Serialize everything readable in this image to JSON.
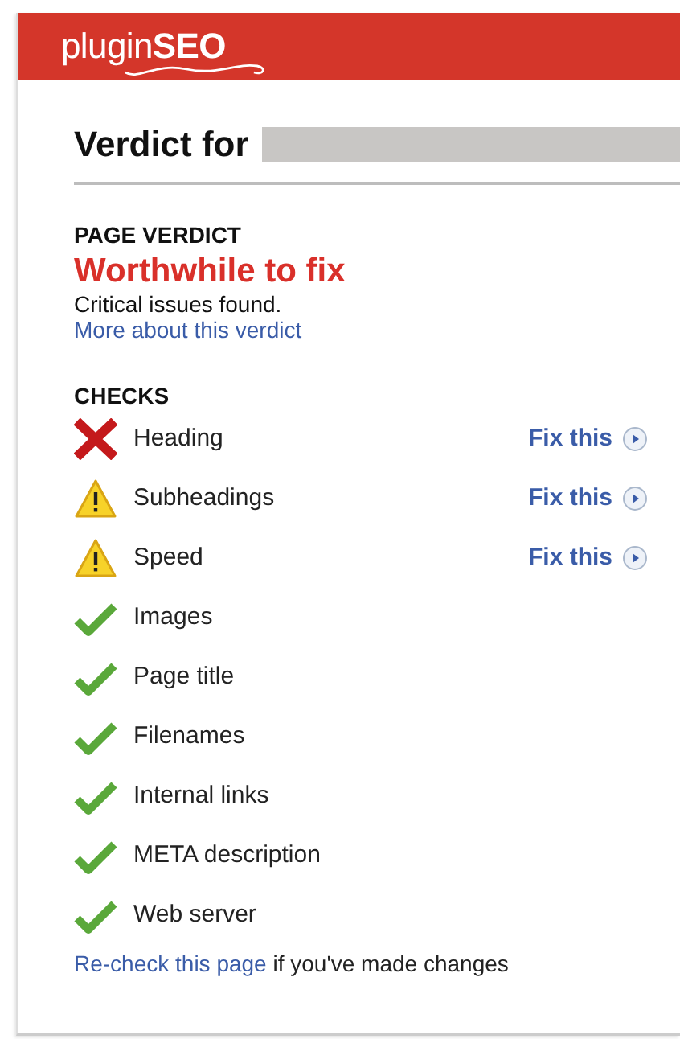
{
  "header": {
    "logo": "plugin**SEO**"
  },
  "title": "Verdict for",
  "verdict": {
    "heading": "PAGE VERDICT",
    "result": "Worthwhile to fix",
    "summary": "Critical issues found.",
    "link": "More about this verdict"
  },
  "checks_heading": "CHECKS",
  "checks": [
    {
      "kind": "fail",
      "label": "Heading",
      "action": "Fix this"
    },
    {
      "kind": "warn",
      "label": "Subheadings",
      "action": "Fix this"
    },
    {
      "kind": "warn",
      "label": "Speed",
      "action": "Fix this"
    },
    {
      "kind": "pass",
      "label": "Images"
    },
    {
      "kind": "pass",
      "label": "Page title"
    },
    {
      "kind": "pass",
      "label": "Filenames"
    },
    {
      "kind": "pass",
      "label": "Internal links"
    },
    {
      "kind": "pass",
      "label": "META description"
    },
    {
      "kind": "pass",
      "label": "Web server"
    }
  ],
  "footer": {
    "link": "Re-check this page",
    "text": "if you've made changes"
  }
}
